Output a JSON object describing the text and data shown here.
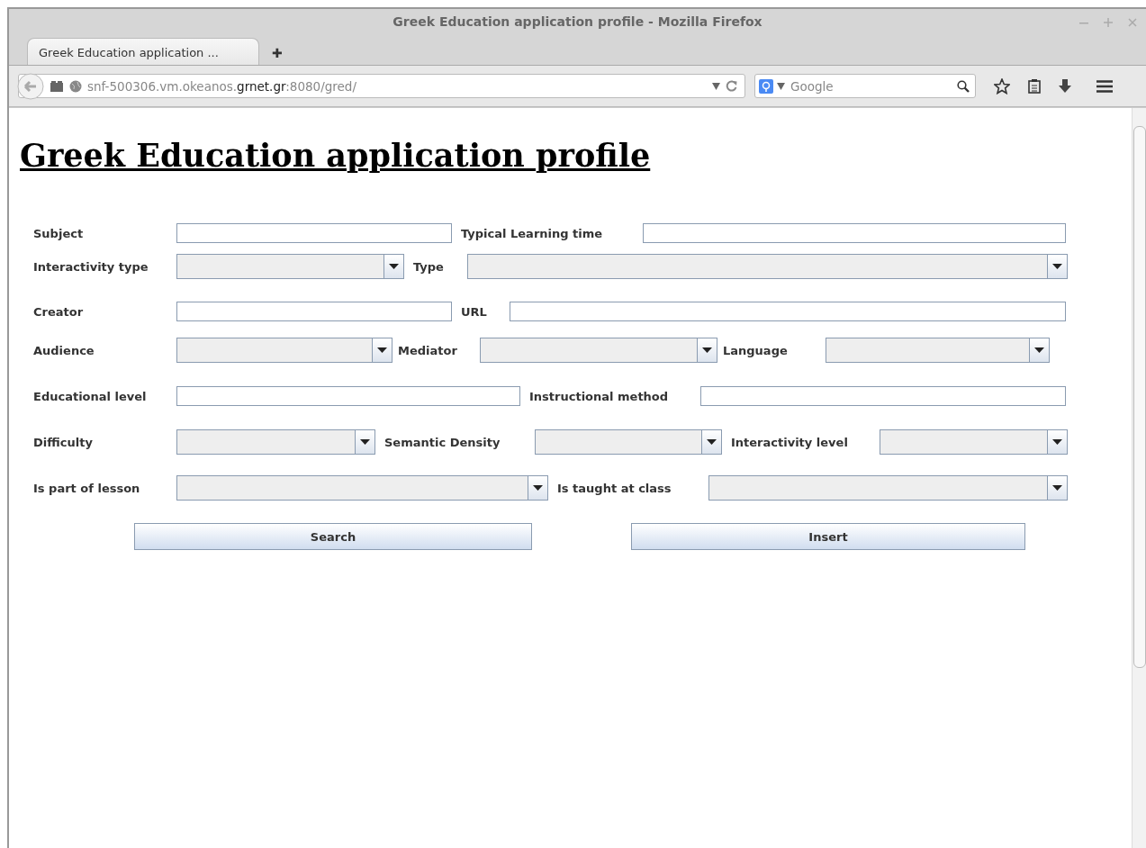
{
  "window": {
    "title": "Greek Education application profile - Mozilla Firefox"
  },
  "tabs": [
    {
      "label": "Greek Education application ...",
      "selected": true
    }
  ],
  "new_tab": "✚",
  "address_bar": {
    "prefix": "snf-500306.vm.okeanos.",
    "domain": "grnet.gr",
    "suffix": ":8080/gred/"
  },
  "search_field": {
    "placeholder": "Google"
  },
  "page": {
    "heading": "Greek Education application profile",
    "rows": [
      [
        {
          "label": "Subject",
          "kind": "text"
        },
        {
          "label": "Typical Learning time",
          "kind": "text"
        }
      ],
      [
        {
          "label": "Interactivity type",
          "kind": "select"
        },
        {
          "label": "Type",
          "kind": "select"
        }
      ],
      [
        {
          "label": "Creator",
          "kind": "text"
        },
        {
          "label": "URL",
          "kind": "text"
        }
      ],
      [
        {
          "label": "Audience",
          "kind": "select"
        },
        {
          "label": "Mediator",
          "kind": "select"
        },
        {
          "label": "Language",
          "kind": "select"
        }
      ],
      [
        {
          "label": "Educational level",
          "kind": "text"
        },
        {
          "label": "Instructional method",
          "kind": "text"
        }
      ],
      [
        {
          "label": "Difficulty",
          "kind": "select"
        },
        {
          "label": "Semantic Density",
          "kind": "select"
        },
        {
          "label": "Interactivity level",
          "kind": "select"
        }
      ],
      [
        {
          "label": "Is part of lesson",
          "kind": "select"
        },
        {
          "label": "Is taught at class",
          "kind": "select"
        }
      ]
    ],
    "buttons": [
      "Search",
      "Insert"
    ]
  }
}
